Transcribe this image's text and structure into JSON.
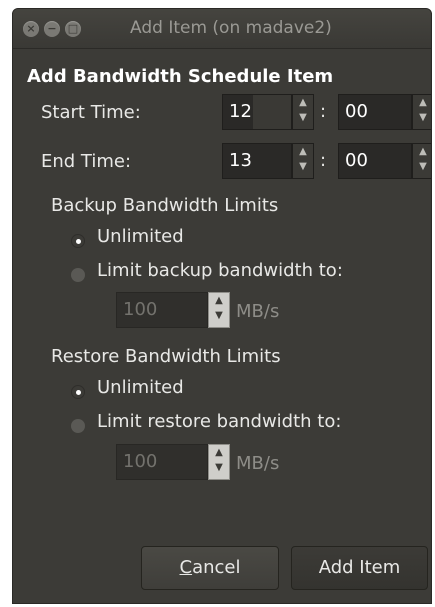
{
  "window": {
    "title": "Add Item (on madave2)"
  },
  "dialog": {
    "heading": "Add Bandwidth Schedule Item",
    "start_label": "Start Time:",
    "start_hour": "12",
    "start_minute": "00",
    "end_label": "End Time:",
    "end_hour": "13",
    "end_minute": "00",
    "colon": ":"
  },
  "backup": {
    "section_label": "Backup Bandwidth Limits",
    "unlimited_label": "Unlimited",
    "limit_label": "Limit backup bandwidth to:",
    "limit_value": "100",
    "unit": "MB/s",
    "selected": "unlimited"
  },
  "restore": {
    "section_label": "Restore Bandwidth Limits",
    "unlimited_label": "Unlimited",
    "limit_label": "Limit restore bandwidth to:",
    "limit_value": "100",
    "unit": "MB/s",
    "selected": "unlimited"
  },
  "buttons": {
    "cancel_mnemonic": "C",
    "cancel_rest": "ancel",
    "add_label": "Add Item"
  },
  "icons": {
    "close": "close-icon",
    "minimize": "minimize-icon",
    "maximize": "maximize-icon"
  }
}
